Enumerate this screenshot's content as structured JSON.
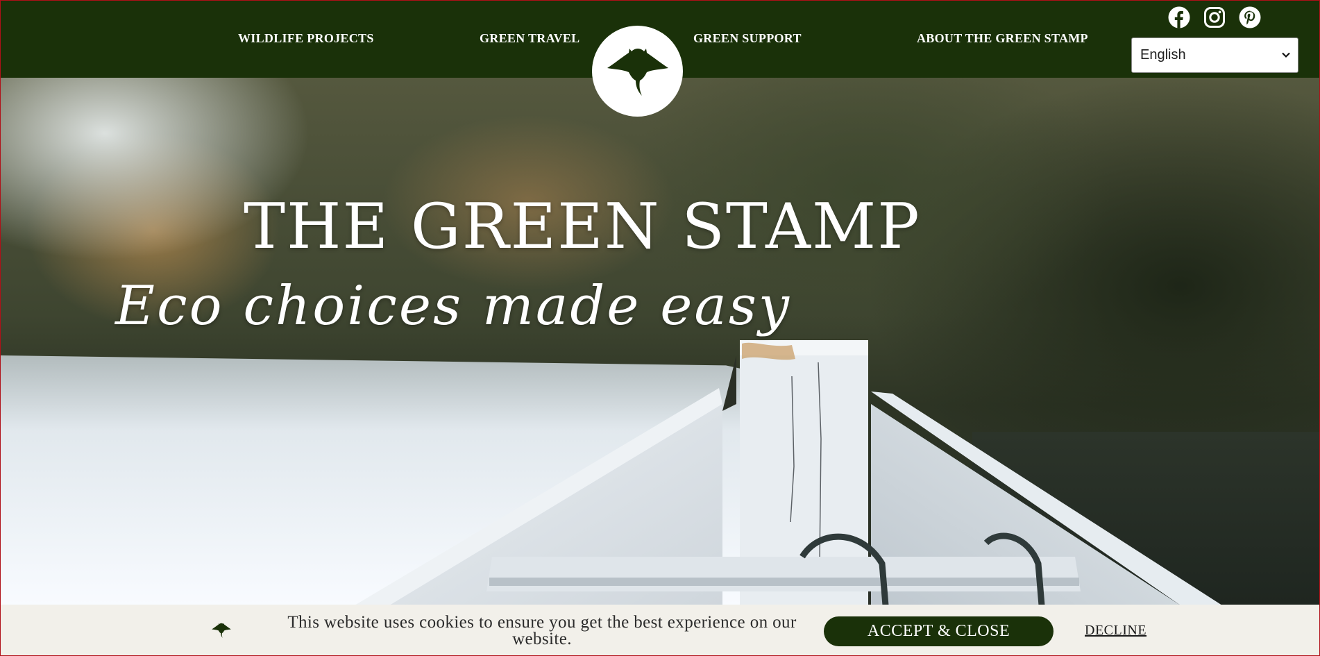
{
  "nav": {
    "links": [
      {
        "label": "WILDLIFE PROJECTS"
      },
      {
        "label": "GREEN TRAVEL"
      },
      {
        "label": "GREEN SUPPORT"
      },
      {
        "label": "ABOUT THE GREEN STAMP"
      }
    ],
    "logo_icon": "manta-ray-icon",
    "socials": [
      "facebook-icon",
      "instagram-icon",
      "pinterest-icon"
    ],
    "language": {
      "selected": "English"
    }
  },
  "hero": {
    "title": "THE GREEN STAMP",
    "tagline": "Eco choices made easy"
  },
  "cookie_bar": {
    "message": "This website uses cookies to ensure you get the best experience on our website.",
    "accept_label": "ACCEPT & CLOSE",
    "decline_label": "DECLINE"
  },
  "colors": {
    "brand_green": "#1a3109",
    "cookie_bg": "#f2f0ea",
    "white": "#ffffff"
  }
}
